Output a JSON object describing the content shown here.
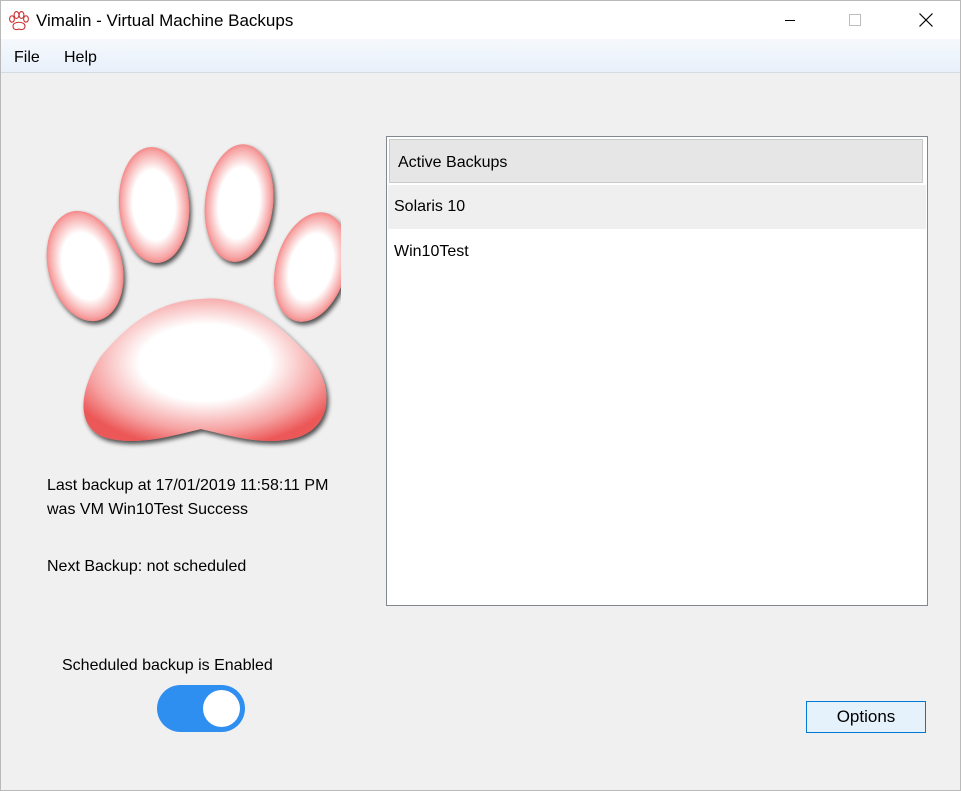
{
  "window": {
    "title": "Vimalin - Virtual Machine Backups"
  },
  "menu": {
    "file": "File",
    "help": "Help"
  },
  "status": {
    "last_backup_line1": "Last backup at 17/01/2019 11:58:11 PM",
    "last_backup_line2": "was VM Win10Test Success",
    "next_backup": "Next Backup: not scheduled"
  },
  "schedule": {
    "label": "Scheduled backup is Enabled",
    "enabled": true
  },
  "backups_list": {
    "header": "Active Backups",
    "items": [
      "Solaris 10",
      "Win10Test"
    ],
    "selected_index": 0
  },
  "buttons": {
    "options": "Options"
  },
  "colors": {
    "toggle_on": "#2e8ff0",
    "button_border": "#0078d7",
    "paw_red": "#ef5f5f"
  },
  "icons": {
    "app": "paw-icon",
    "logo": "paw-logo"
  }
}
